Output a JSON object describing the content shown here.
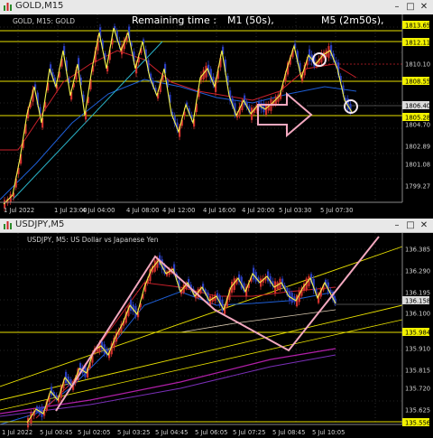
{
  "colors": {
    "background": "#000000",
    "grid": "#4a4a4a",
    "up_candle": "#d0312d",
    "down_candle": "#2b3fbf",
    "zigzag": "#f5f54a",
    "ma_red": "#c8202a",
    "ma_blue": "#1e5ed6",
    "ma_cyan": "#2ab3c8",
    "level_line": "#e8e000",
    "annotation_pink": "#f3a8bf",
    "price_tag": "#f2f200",
    "axis_text": "#cfcfcf"
  },
  "window_top": {
    "title": "GOLD,M15",
    "overlay_label": "GOLD, M15:  GOLD",
    "remaining_time_label": "Remaining time :",
    "m1_timer": "M1 (50s),",
    "m5_timer": "M5 (2m50s),",
    "price_labels": [
      "1813.65",
      "1812.11",
      "1810.10",
      "1808.55",
      "1806.40",
      "1805.28",
      "1804.70",
      "1802.89",
      "1801.08",
      "1799.27"
    ],
    "time_labels": [
      "1 Jul 2022",
      "1 Jul 23:00",
      "4 Jul 04:00",
      "4 Jul 08:00",
      "4 Jul 12:00",
      "4 Jul 16:00",
      "4 Jul 20:00",
      "5 Jul 03:30",
      "5 Jul 07:30"
    ],
    "controls": {
      "minimize": "–",
      "maximize": "□",
      "close": "✕"
    }
  },
  "window_bottom": {
    "title": "USDJPY,M5",
    "overlay_label": "USDJPY, M5:  US Dollar vs Japanese Yen",
    "price_labels": [
      "136.385",
      "136.290",
      "136.195",
      "136.158",
      "136.100",
      "135.984",
      "135.910",
      "135.815",
      "135.720",
      "135.625",
      "135.556"
    ],
    "time_labels": [
      "1 Jul 2022",
      "5 Jul 00:45",
      "5 Jul 02:05",
      "5 Jul 03:25",
      "5 Jul 04:45",
      "5 Jul 06:05",
      "5 Jul 07:25",
      "5 Jul 08:45",
      "5 Jul 10:05"
    ],
    "controls": {
      "minimize": "–",
      "maximize": "□",
      "close": "✕"
    }
  }
}
